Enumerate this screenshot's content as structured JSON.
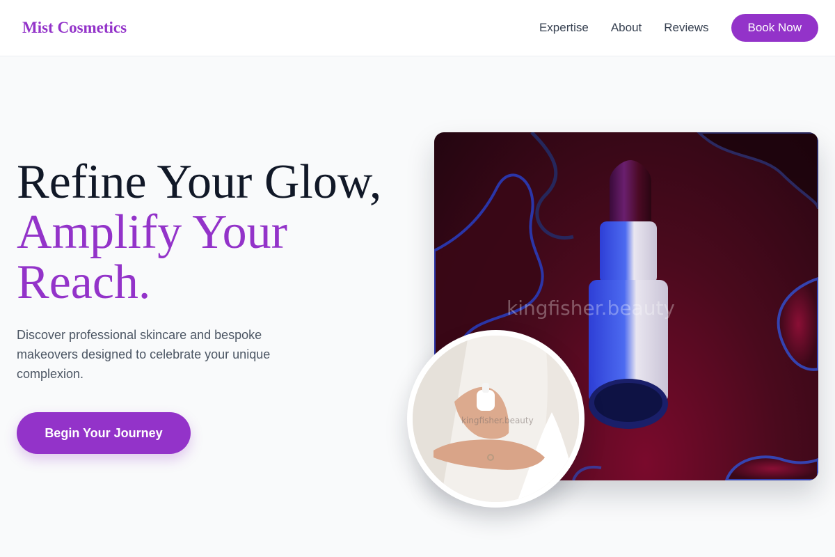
{
  "brand": {
    "name": "Mist Cosmetics",
    "accent": "#9333c9"
  },
  "nav": {
    "items": [
      {
        "label": "Expertise"
      },
      {
        "label": "About"
      },
      {
        "label": "Reviews"
      }
    ],
    "cta_label": "Book Now"
  },
  "hero": {
    "title_line1": "Refine Your Glow,",
    "title_line2": "Amplify Your Reach.",
    "description": "Discover professional skincare and bespoke makeovers designed to celebrate your unique complexion.",
    "cta_label": "Begin Your Journey"
  },
  "images": {
    "main_watermark": "kingfisher.beauty",
    "circle_watermark": "kingfisher.beauty"
  }
}
